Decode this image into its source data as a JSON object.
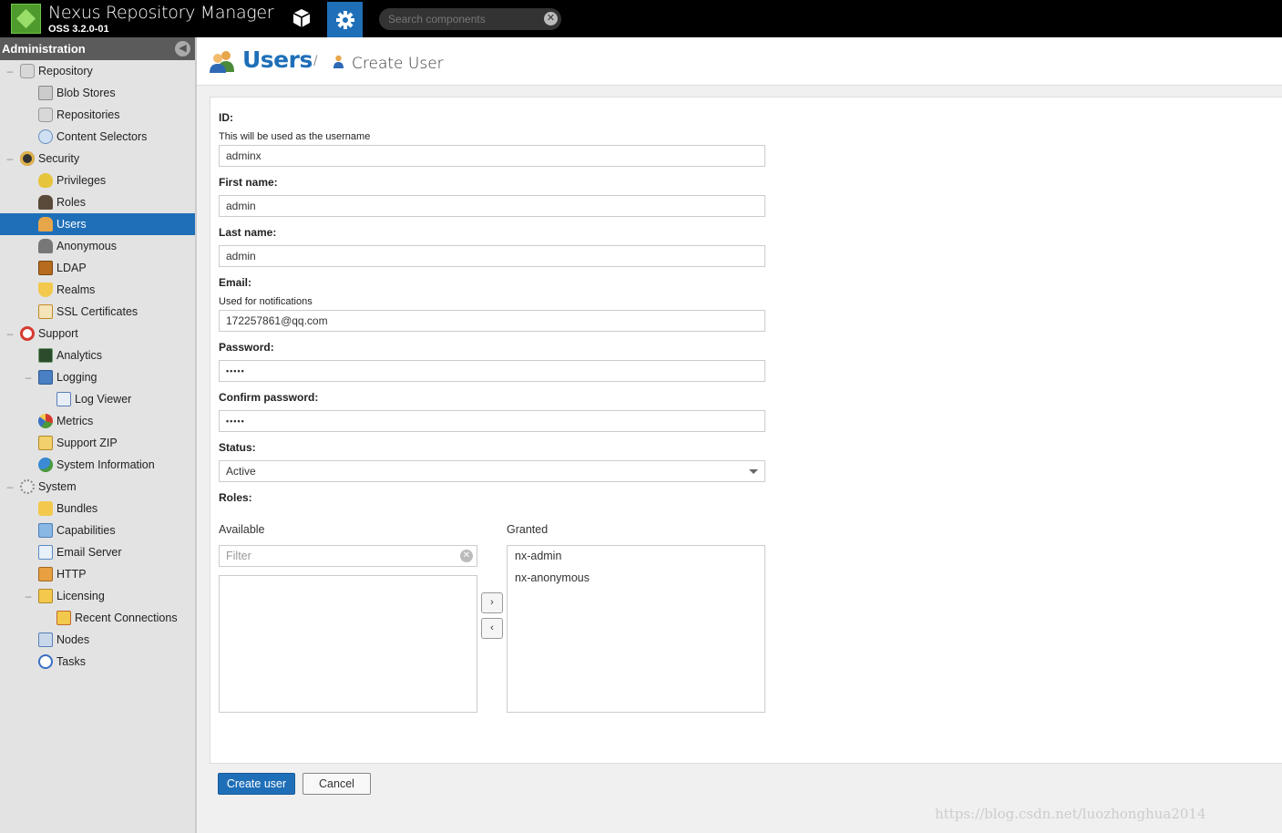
{
  "header": {
    "app_title": "Nexus Repository Manager",
    "app_version": "OSS 3.2.0-01",
    "search_placeholder": "Search components"
  },
  "sidebar": {
    "title": "Administration",
    "items": [
      {
        "label": "Repository",
        "icon": "database-icon",
        "level": 0,
        "toggle": "–"
      },
      {
        "label": "Blob Stores",
        "icon": "hard-drive-icon",
        "level": 1
      },
      {
        "label": "Repositories",
        "icon": "database-icon",
        "level": 1
      },
      {
        "label": "Content Selectors",
        "icon": "selector-icon",
        "level": 1
      },
      {
        "label": "Security",
        "icon": "security-icon",
        "level": 0,
        "toggle": "–"
      },
      {
        "label": "Privileges",
        "icon": "medal-icon",
        "level": 1
      },
      {
        "label": "Roles",
        "icon": "role-icon",
        "level": 1
      },
      {
        "label": "Users",
        "icon": "users-icon",
        "level": 1,
        "selected": true
      },
      {
        "label": "Anonymous",
        "icon": "anonymous-icon",
        "level": 1
      },
      {
        "label": "LDAP",
        "icon": "ldap-book-icon",
        "level": 1
      },
      {
        "label": "Realms",
        "icon": "shield-icon",
        "level": 1
      },
      {
        "label": "SSL Certificates",
        "icon": "certificate-icon",
        "level": 1
      },
      {
        "label": "Support",
        "icon": "lifebuoy-icon",
        "level": 0,
        "toggle": "–"
      },
      {
        "label": "Analytics",
        "icon": "analytics-icon",
        "level": 1
      },
      {
        "label": "Logging",
        "icon": "log-book-icon",
        "level": 1,
        "toggle": "–"
      },
      {
        "label": "Log Viewer",
        "icon": "scroll-icon",
        "level": 2
      },
      {
        "label": "Metrics",
        "icon": "pie-chart-icon",
        "level": 1
      },
      {
        "label": "Support ZIP",
        "icon": "zip-icon",
        "level": 1
      },
      {
        "label": "System Information",
        "icon": "globe-icon",
        "level": 1
      },
      {
        "label": "System",
        "icon": "gear-icon",
        "level": 0,
        "toggle": "–"
      },
      {
        "label": "Bundles",
        "icon": "puzzle-icon",
        "level": 1
      },
      {
        "label": "Capabilities",
        "icon": "cube-icon",
        "level": 1
      },
      {
        "label": "Email Server",
        "icon": "envelope-icon",
        "level": 1
      },
      {
        "label": "HTTP",
        "icon": "truck-icon",
        "level": 1
      },
      {
        "label": "Licensing",
        "icon": "license-icon",
        "level": 1,
        "toggle": "–"
      },
      {
        "label": "Recent Connections",
        "icon": "connections-icon",
        "level": 2
      },
      {
        "label": "Nodes",
        "icon": "nodes-icon",
        "level": 1
      },
      {
        "label": "Tasks",
        "icon": "clock-icon",
        "level": 1
      }
    ]
  },
  "page": {
    "title": "Users",
    "separator": "/",
    "subtitle": "Create User"
  },
  "form": {
    "id_label": "ID:",
    "id_hint": "This will be used as the username",
    "id_value": "adminx",
    "first_name_label": "First name:",
    "first_name_value": "admin",
    "last_name_label": "Last name:",
    "last_name_value": "admin",
    "email_label": "Email:",
    "email_hint": "Used for notifications",
    "email_value": "172257861@qq.com",
    "password_label": "Password:",
    "password_value": "•••••",
    "confirm_label": "Confirm password:",
    "confirm_value": "•••••",
    "status_label": "Status:",
    "status_value": "Active",
    "roles_label": "Roles:",
    "available_label": "Available",
    "filter_placeholder": "Filter",
    "granted_label": "Granted",
    "granted_roles": [
      "nx-admin",
      "nx-anonymous"
    ],
    "move_right": "›",
    "move_left": "‹",
    "create_button": "Create user",
    "cancel_button": "Cancel"
  },
  "watermark": "https://blog.csdn.net/luozhonghua2014",
  "colors": {
    "accent": "#1f6fb8",
    "header_bg": "#000000",
    "sidebar_bg": "#e3e3e3"
  }
}
